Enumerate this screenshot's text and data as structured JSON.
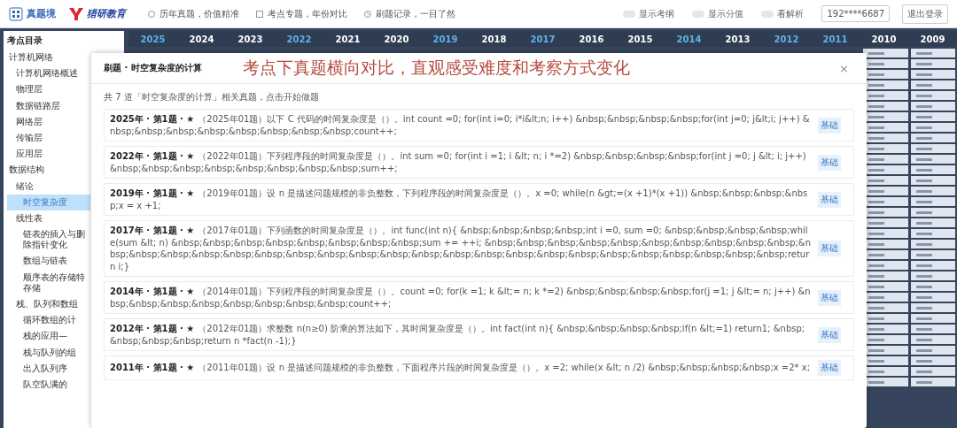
{
  "header": {
    "brand": "真题境",
    "partner": "猎研教育",
    "menu": [
      {
        "label": "历年真题，价值精准"
      },
      {
        "label": "考点专题，年份对比"
      },
      {
        "label": "刷题记录，一目了然"
      }
    ],
    "toggles": [
      {
        "label": "显示考纲",
        "on": false
      },
      {
        "label": "显示分值",
        "on": false
      },
      {
        "label": "看解析",
        "on": false
      }
    ],
    "account": "192****6687",
    "logout": "退出登录"
  },
  "sidebar": {
    "title": "考点目录",
    "items": [
      {
        "label": "计算机网络",
        "selected": false,
        "children": [
          {
            "label": "计算机网络概述",
            "selected": false
          },
          {
            "label": "物理层",
            "selected": false
          },
          {
            "label": "数据链路层",
            "selected": false
          },
          {
            "label": "网络层",
            "selected": false
          },
          {
            "label": "传输层",
            "selected": false
          },
          {
            "label": "应用层",
            "selected": false
          }
        ]
      },
      {
        "label": "数据结构",
        "selected": false,
        "children": [
          {
            "label": "绪论",
            "selected": false,
            "children": [
              {
                "label": "时空复杂度",
                "selected": true
              }
            ]
          },
          {
            "label": "线性表",
            "selected": false,
            "children": [
              {
                "label": "链表的插入与删除指针变化",
                "selected": false
              },
              {
                "label": "数组与链表",
                "selected": false
              },
              {
                "label": "顺序表的存储特存储",
                "selected": false
              }
            ]
          },
          {
            "label": "栈、队列和数组",
            "selected": false,
            "children": [
              {
                "label": "循环数组的计",
                "selected": false
              },
              {
                "label": "栈的应用—",
                "selected": false
              },
              {
                "label": "栈与队列的组",
                "selected": false
              },
              {
                "label": "出入队列序",
                "selected": false
              },
              {
                "label": "队空队满的",
                "selected": false
              }
            ]
          }
        ]
      }
    ]
  },
  "years": [
    {
      "label": "2025",
      "highlighted": true
    },
    {
      "label": "2024",
      "highlighted": false
    },
    {
      "label": "2023",
      "highlighted": false
    },
    {
      "label": "2022",
      "highlighted": true
    },
    {
      "label": "2021",
      "highlighted": false
    },
    {
      "label": "2020",
      "highlighted": false
    },
    {
      "label": "2019",
      "highlighted": true
    },
    {
      "label": "2018",
      "highlighted": false
    },
    {
      "label": "2017",
      "highlighted": true
    },
    {
      "label": "2016",
      "highlighted": false
    },
    {
      "label": "2015",
      "highlighted": false
    },
    {
      "label": "2014",
      "highlighted": true
    },
    {
      "label": "2013",
      "highlighted": false
    },
    {
      "label": "2012",
      "highlighted": true
    },
    {
      "label": "2011",
      "highlighted": true
    },
    {
      "label": "2010",
      "highlighted": false
    },
    {
      "label": "2009",
      "highlighted": false
    }
  ],
  "dialog": {
    "title": "刷题 · 时空复杂度的计算",
    "caption": "考点下真题横向对比，直观感受难度和考察方式变化",
    "close": "×",
    "summary": "共 7 道「时空复杂度的计算」相关真题，点击开始做题",
    "questions": [
      {
        "heading": "2025年 · 第1题 · ★",
        "text": "（2025年01题）以下 C 代码的时间复杂度是（）。int count =0; for(int i=0; i*i&lt;n; i++) &nbsp;&nbsp;&nbsp;&nbsp;for(int j=0; j&lt;i; j++) &nbsp;&nbsp;&nbsp;&nbsp;&nbsp;&nbsp;&nbsp;&nbsp;count++;",
        "tag": "基础"
      },
      {
        "heading": "2022年 · 第1题 · ★",
        "text": "（2022年01题）下列程序段的时间复杂度是（）。int sum =0; for(int i =1; i &lt; n; i *=2) &nbsp;&nbsp;&nbsp;&nbsp;for(int j =0; j &lt; i; j++) &nbsp;&nbsp;&nbsp;&nbsp;&nbsp;&nbsp;&nbsp;&nbsp;sum++;",
        "tag": "基础"
      },
      {
        "heading": "2019年 · 第1题 · ★",
        "text": "（2019年01题）设 n 是描述问题规模的非负整数，下列程序段的时间复杂度是（）。x =0; while(n &gt;=(x +1)*(x +1)) &nbsp;&nbsp;&nbsp;&nbsp;x = x +1;",
        "tag": "基础"
      },
      {
        "heading": "2017年 · 第1题 · ★",
        "text": "（2017年01题）下列函数的时间复杂度是（）。int func(int n){ &nbsp;&nbsp;&nbsp;&nbsp;int i =0, sum =0; &nbsp;&nbsp;&nbsp;&nbsp;while(sum &lt; n) &nbsp;&nbsp;&nbsp;&nbsp;&nbsp;&nbsp;&nbsp;&nbsp;sum += ++i; &nbsp;&nbsp;&nbsp;&nbsp;&nbsp;&nbsp;&nbsp;&nbsp;&nbsp;&nbsp;&nbsp;&nbsp;&nbsp;&nbsp;&nbsp;&nbsp;&nbsp;&nbsp;&nbsp;&nbsp;&nbsp;&nbsp;&nbsp;&nbsp;&nbsp;&nbsp;&nbsp;&nbsp;&nbsp;&nbsp;&nbsp;&nbsp;return i;}",
        "tag": "基础"
      },
      {
        "heading": "2014年 · 第1题 · ★",
        "text": "（2014年01题）下列程序段的时间复杂度是（）。count =0; for(k =1; k &lt;= n; k *=2) &nbsp;&nbsp;&nbsp;&nbsp;for(j =1; j &lt;= n; j++) &nbsp;&nbsp;&nbsp;&nbsp;&nbsp;&nbsp;&nbsp;&nbsp;count++;",
        "tag": "基础"
      },
      {
        "heading": "2012年 · 第1题 · ★",
        "text": "（2012年01题）求整数 n(n≥0) 阶乘的算法如下，其时间复杂度是（）。int fact(int n){ &nbsp;&nbsp;&nbsp;&nbsp;if(n &lt;=1) return1; &nbsp;&nbsp;&nbsp;&nbsp;return n *fact(n -1);}",
        "tag": "基础"
      },
      {
        "heading": "2011年 · 第1题 · ★",
        "text": "（2011年01题）设 n 是描述问题规模的非负整数，下面程序片段的时间复杂度是（）。x =2; while(x &lt; n /2) &nbsp;&nbsp;&nbsp;&nbsp;x =2* x;",
        "tag": "基础"
      }
    ]
  }
}
